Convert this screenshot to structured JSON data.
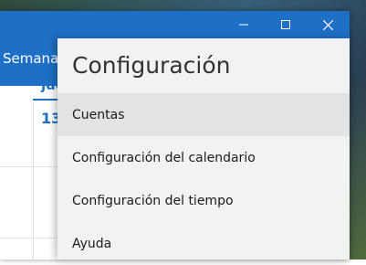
{
  "window": {
    "controls": {
      "minimize_icon": "minimize-icon",
      "maximize_icon": "maximize-icon",
      "close_icon": "close-icon"
    },
    "accent_color": "#1e6fc6"
  },
  "calendar": {
    "view_label": "Semana la",
    "day_header": "jue",
    "day_number": "13"
  },
  "settings_panel": {
    "title": "Configuración",
    "items": [
      {
        "label": "Cuentas",
        "selected": true
      },
      {
        "label": "Configuración del calendario",
        "selected": false
      },
      {
        "label": "Configuración del tiempo",
        "selected": false
      },
      {
        "label": "Ayuda",
        "selected": false
      }
    ]
  }
}
